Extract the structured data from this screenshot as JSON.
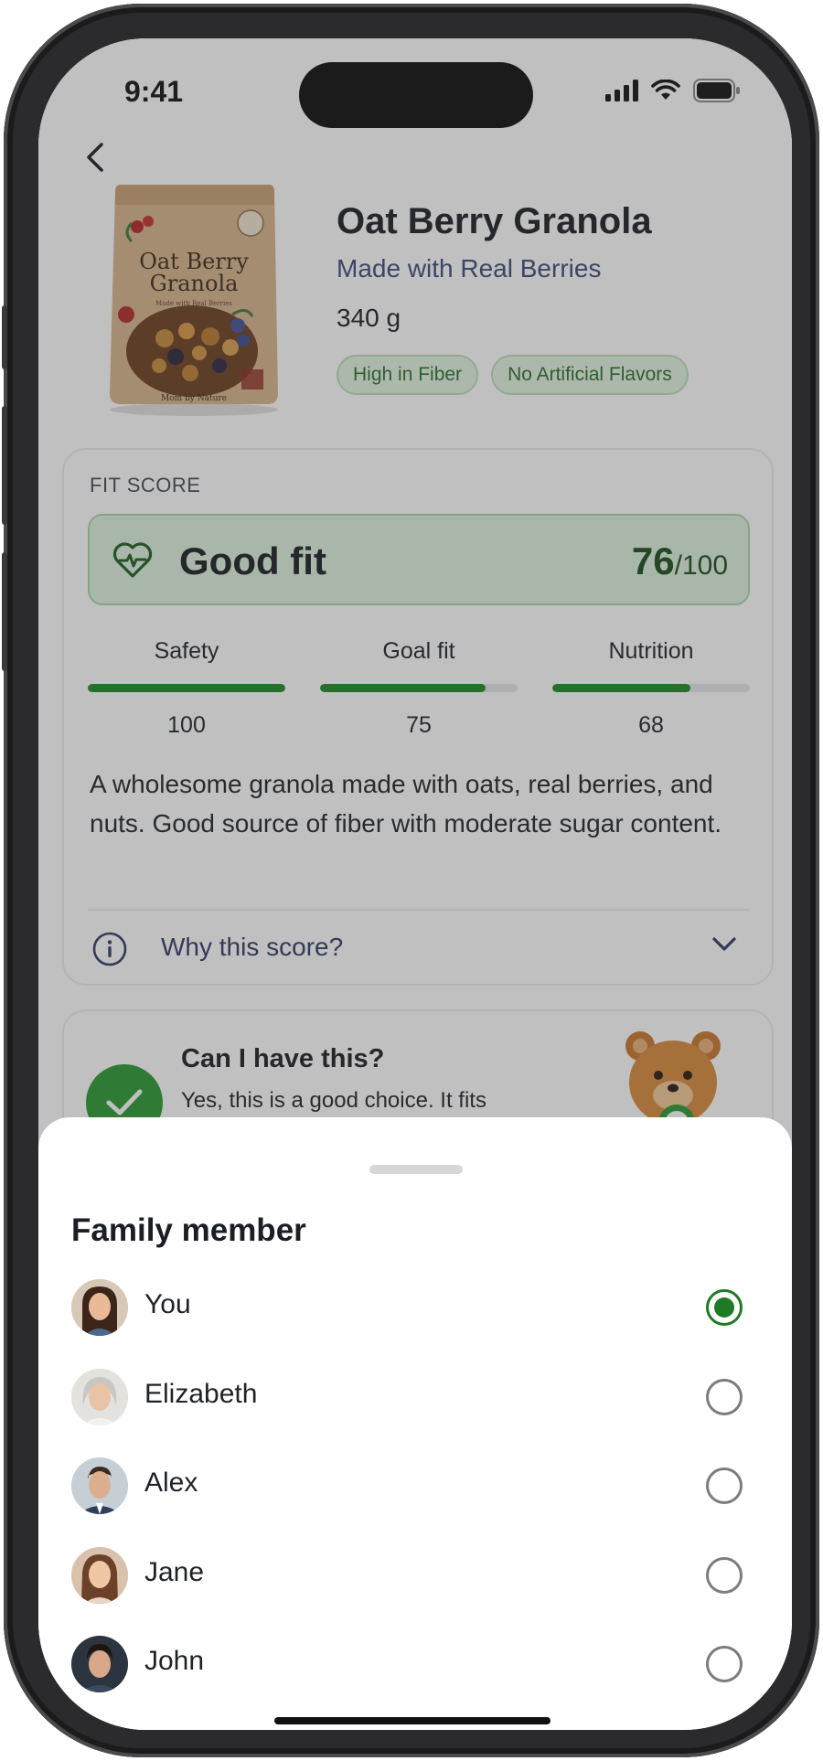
{
  "status_bar": {
    "time": "9:41"
  },
  "product": {
    "title": "Oat Berry Granola",
    "subtitle": "Made with Real Berries",
    "weight": "340 g",
    "tags": [
      "High in Fiber",
      "No Artificial Flavors"
    ],
    "package_text": {
      "line1": "Oat Berry",
      "line2": "Granola",
      "small": "Made with Real Berries"
    }
  },
  "fit_score": {
    "label": "FIT SCORE",
    "verdict": "Good fit",
    "score": "76",
    "max": "/100",
    "metrics": [
      {
        "name": "Safety",
        "value": "100",
        "percent": 100
      },
      {
        "name": "Goal fit",
        "value": "75",
        "percent": 84
      },
      {
        "name": "Nutrition",
        "value": "68",
        "percent": 70
      }
    ],
    "description": "A wholesome granola made with oats, real berries, and nuts. Good source of fiber with moderate sugar content.",
    "why_label": "Why this score?"
  },
  "can_have": {
    "title": "Can I have this?",
    "text": "Yes, this is a good choice. It fits"
  },
  "sheet": {
    "title": "Family member",
    "members": [
      {
        "name": "You",
        "selected": true
      },
      {
        "name": "Elizabeth",
        "selected": false
      },
      {
        "name": "Alex",
        "selected": false
      },
      {
        "name": "Jane",
        "selected": false
      },
      {
        "name": "John",
        "selected": false
      }
    ]
  },
  "colors": {
    "accent_green": "#1f7a25",
    "bar_green": "#1e8a22",
    "fit_banner_bg": "#def2df",
    "link_navy": "#2e3a66"
  }
}
